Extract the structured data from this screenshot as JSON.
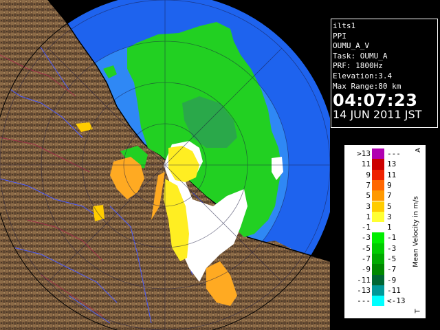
{
  "info": {
    "site": "ilts1",
    "product": "PPI",
    "scan": "OUMU_A_V",
    "task": "Task: OUMU_A",
    "prf": "PRF: 1800Hz",
    "elevation": "Elevation:3.4",
    "max_range": "Max Range:80 km",
    "time": "04:07:23",
    "date": "14 JUN 2011 JST"
  },
  "legend": {
    "unit_label": "Mean Velocity in m/s",
    "top_mark": "A",
    "bottom_mark": "T",
    "rows": [
      {
        "left": ">13",
        "right": "---",
        "color": "#b000b0"
      },
      {
        "left": "11",
        "right": "13",
        "color": "#cc0000"
      },
      {
        "left": "9",
        "right": "11",
        "color": "#ee2200"
      },
      {
        "left": "7",
        "right": "9",
        "color": "#ff6600"
      },
      {
        "left": "5",
        "right": "7",
        "color": "#ff9900"
      },
      {
        "left": "3",
        "right": "5",
        "color": "#ffcc00"
      },
      {
        "left": "1",
        "right": "3",
        "color": "#ffff33"
      },
      {
        "left": "-1",
        "right": "1",
        "color": "#ffffff"
      },
      {
        "left": "-3",
        "right": "-1",
        "color": "#00ee00"
      },
      {
        "left": "-5",
        "right": "-3",
        "color": "#00cc00"
      },
      {
        "left": "-7",
        "right": "-5",
        "color": "#00aa00"
      },
      {
        "left": "-9",
        "right": "-7",
        "color": "#008800"
      },
      {
        "left": "-11",
        "right": "-9",
        "color": "#006633"
      },
      {
        "left": "-13",
        "right": "-11",
        "color": "#009999"
      },
      {
        "left": "---",
        "right": "<-13",
        "color": "#00ffff"
      }
    ]
  },
  "colors": {
    "ocean_deep": "#1e63ee",
    "ocean_near": "#2f88f5",
    "land": "#7a5a3c",
    "velocity_green": "#22d022",
    "velocity_dark_green": "#2aa84a",
    "velocity_yellow": "#ffee22",
    "velocity_orange": "#ffaa22",
    "zero_white": "#ffffff"
  }
}
